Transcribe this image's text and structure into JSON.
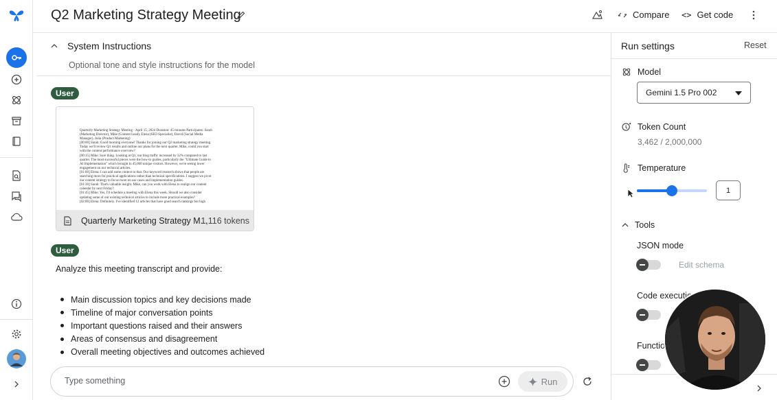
{
  "header": {
    "title": "Q2 Marketing Strategy Meeting",
    "compare_label": "Compare",
    "get_code_label": "Get code"
  },
  "system_instructions": {
    "label": "System Instructions",
    "placeholder": "Optional tone and style instructions for the model"
  },
  "messages": [
    {
      "role": "User",
      "attachment": {
        "name": "Quarterly Marketing Strategy M...",
        "tokens": "1,116 tokens",
        "preview_lines": [
          "Quarterly Marketing Strategy Meeting - April 15, 2024 Duration: 45 minutes Participants: Sarah",
          "(Marketing Director), Mike (Content Lead), Elena (SEO Specialist), David (Social Media",
          "Manager), Julia (Product Marketing)",
          "[00:00] Sarah: Good morning everyone! Thanks for joining our Q2 marketing strategy meeting.",
          "Today we'll review Q1 results and outline our plans for the next quarter. Mike, could you start",
          "with the content performance overview?",
          "[00:15] Mike: Sure thing. Looking at Q1, our blog traffic increased by 32% compared to last",
          "quarter. The most successful pieces were the how-to guides, particularly the \"Ultimate Guide to",
          "AI Implementation\" which brought in 45,000 unique visitors. However, we're seeing lower",
          "engagement on our technical articles.",
          "[01:00] Elena: I can add some context to that. Our keyword research shows that people are",
          "searching more for practical applications rather than technical specifications. I suggest we pivot",
          "our content strategy to focus more on use cases and implementation guides.",
          "[01:30] Sarah: That's valuable insight. Mike, can you work with Elena to realign our content",
          "calendar by next Friday?",
          "[01:45] Mike: Yes, I'll schedule a meeting with Elena this week. Should we also consider",
          "updating some of our existing technical articles to include more practical examples?",
          "[02:00] Elena: Definitely. I've identified 12 articles that have good search rankings but high"
        ]
      }
    },
    {
      "role": "User",
      "text": "Analyze this meeting transcript and provide:",
      "bullets": [
        "Main discussion topics and key decisions made",
        "Timeline of major conversation points",
        "Important questions raised and their answers",
        "Areas of consensus and disagreement",
        "Overall meeting objectives and outcomes achieved"
      ]
    }
  ],
  "input": {
    "placeholder": "Type something",
    "run_label": "Run"
  },
  "run_settings": {
    "title": "Run settings",
    "reset_label": "Reset",
    "model_label": "Model",
    "model_value": "Gemini 1.5 Pro 002",
    "token_count_label": "Token Count",
    "token_count_value": "3,462 / 2,000,000",
    "temperature_label": "Temperature",
    "temperature_value": "1",
    "temperature_fraction": 0.5,
    "tools_label": "Tools",
    "json_mode_label": "JSON mode",
    "edit_schema_label": "Edit schema",
    "code_execution_label": "Code executio",
    "function_label": "Functio"
  },
  "colors": {
    "accent": "#1a73e8",
    "user_chip": "#2e5c3f",
    "logo": "#1a73e8"
  },
  "icons": {
    "rail": [
      "logo-icon",
      "key-icon",
      "add-circle-icon",
      "atom-icon",
      "archive-icon",
      "book-icon",
      "doc-search-icon",
      "chat-icon",
      "cloud-icon",
      "info-icon",
      "settings-icon",
      "avatar",
      "chevron-right-icon"
    ]
  }
}
